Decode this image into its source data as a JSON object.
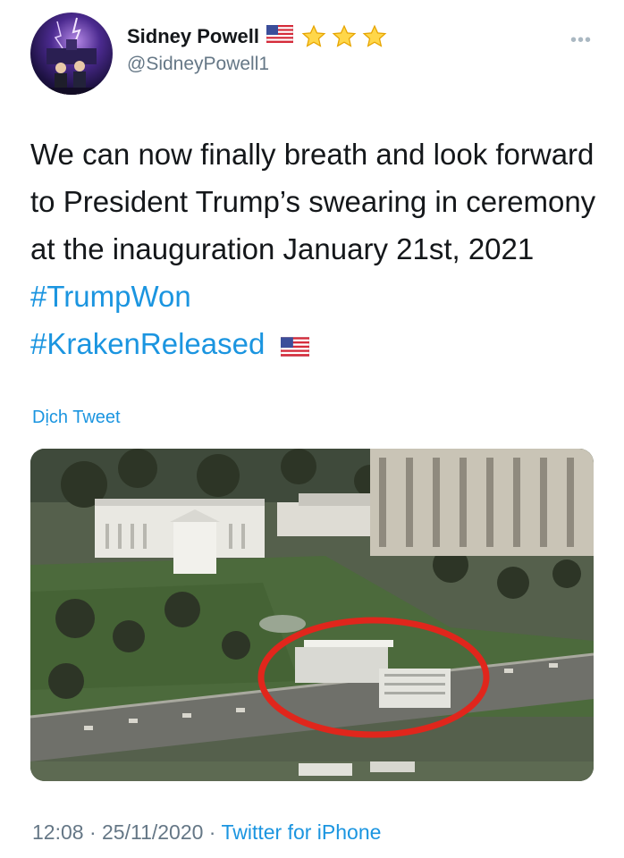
{
  "user": {
    "display_name": "Sidney Powell",
    "handle": "@SidneyPowell1",
    "avatar_icon": "avatar-photo",
    "name_emojis": [
      "us-flag-icon",
      "star-icon",
      "star-icon",
      "star-icon"
    ]
  },
  "tweet": {
    "text_parts": [
      "We can now finally breath and look forward to President Trump’s swearing in ceremony at the inauguration January 21st, 2021 ",
      "#TrumpWon",
      "#KrakenReleased"
    ],
    "translate_label": "Dịch Tweet",
    "media_icon": "white-house-aerial-photo"
  },
  "meta": {
    "time": "12:08",
    "separator": " · ",
    "date": "25/11/2020",
    "source": "Twitter for iPhone"
  },
  "colors": {
    "link": "#1b95e0",
    "secondary_text": "#657786",
    "annotation_circle": "#e0261c"
  }
}
